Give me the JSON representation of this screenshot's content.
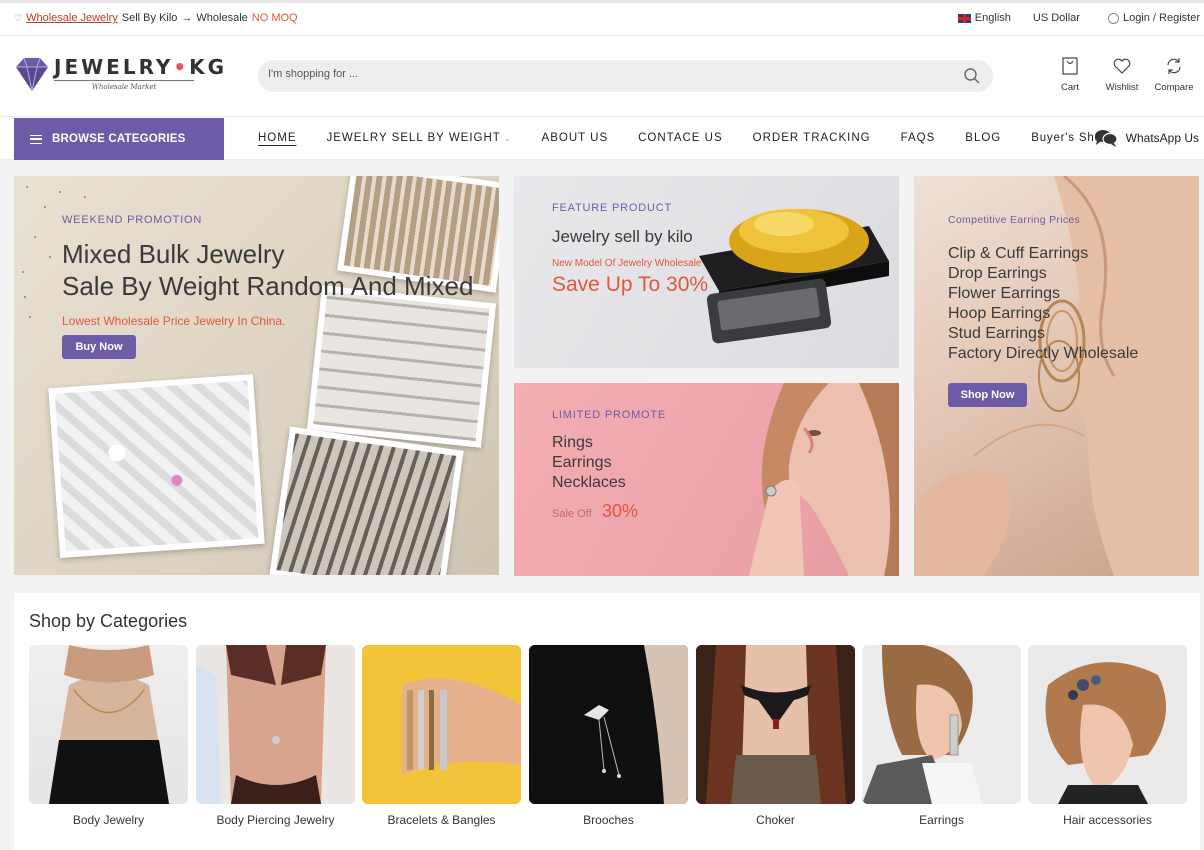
{
  "topbar": {
    "link": "Wholesale Jewelry",
    "text1": "Sell By Kilo",
    "arrow": "→",
    "text2": "Wholesale",
    "text3": "NO MOQ",
    "language": "English",
    "currency": "US Dollar",
    "login": "Login / Register"
  },
  "header": {
    "logo_main": "JEWELRY",
    "logo_dot": "•",
    "logo_end": "KG",
    "logo_sub": "Wholesale Market",
    "search_placeholder": "I'm shopping for ...",
    "icons": [
      {
        "label": "Cart"
      },
      {
        "label": "Wishlist"
      },
      {
        "label": "Compare"
      }
    ]
  },
  "nav": {
    "browse": "BROWSE CATEGORIES",
    "items": [
      "HOME",
      "JEWELRY SELL BY WEIGHT",
      "ABOUT US",
      "CONTACE US",
      "ORDER TRACKING",
      "FAQS",
      "BLOG",
      "Buyer's Show"
    ],
    "whatsapp": "WhatsApp Us"
  },
  "banners": {
    "b1": {
      "eyebrow": "WEEKEND PROMOTION",
      "title1": "Mixed Bulk Jewelry",
      "title2": "Sale By Weight Random And Mixed",
      "sub": "Lowest Wholesale Price Jewelry In China.",
      "button": "Buy Now"
    },
    "b2": {
      "eyebrow": "FEATURE PRODUCT",
      "title": "Jewelry sell by kilo",
      "sub": "New Model Of Jewelry Wholesale",
      "highlight": "Save Up To 30%"
    },
    "b3": {
      "eyebrow": "LIMITED PROMOTE",
      "lines": [
        "Rings",
        "Earrings",
        "Necklaces"
      ],
      "sale_label": "Sale Off",
      "sale_value": "30%"
    },
    "b4": {
      "eyebrow": "Competitive Earring Prices",
      "lines": [
        "Clip & Cuff Earrings",
        "Drop Earrings",
        "Flower Earrings",
        "Hoop Earrings",
        "Stud Earrings",
        "Factory Directly Wholesale"
      ],
      "button": "Shop Now"
    }
  },
  "categories": {
    "title": "Shop by Categories",
    "items": [
      {
        "label": "Body Jewelry"
      },
      {
        "label": "Body Piercing Jewelry"
      },
      {
        "label": "Bracelets & Bangles"
      },
      {
        "label": "Brooches"
      },
      {
        "label": "Choker"
      },
      {
        "label": "Earrings"
      },
      {
        "label": "Hair accessories"
      }
    ]
  },
  "colors": {
    "accent": "#6e5ba8",
    "highlight": "#e0573b"
  }
}
